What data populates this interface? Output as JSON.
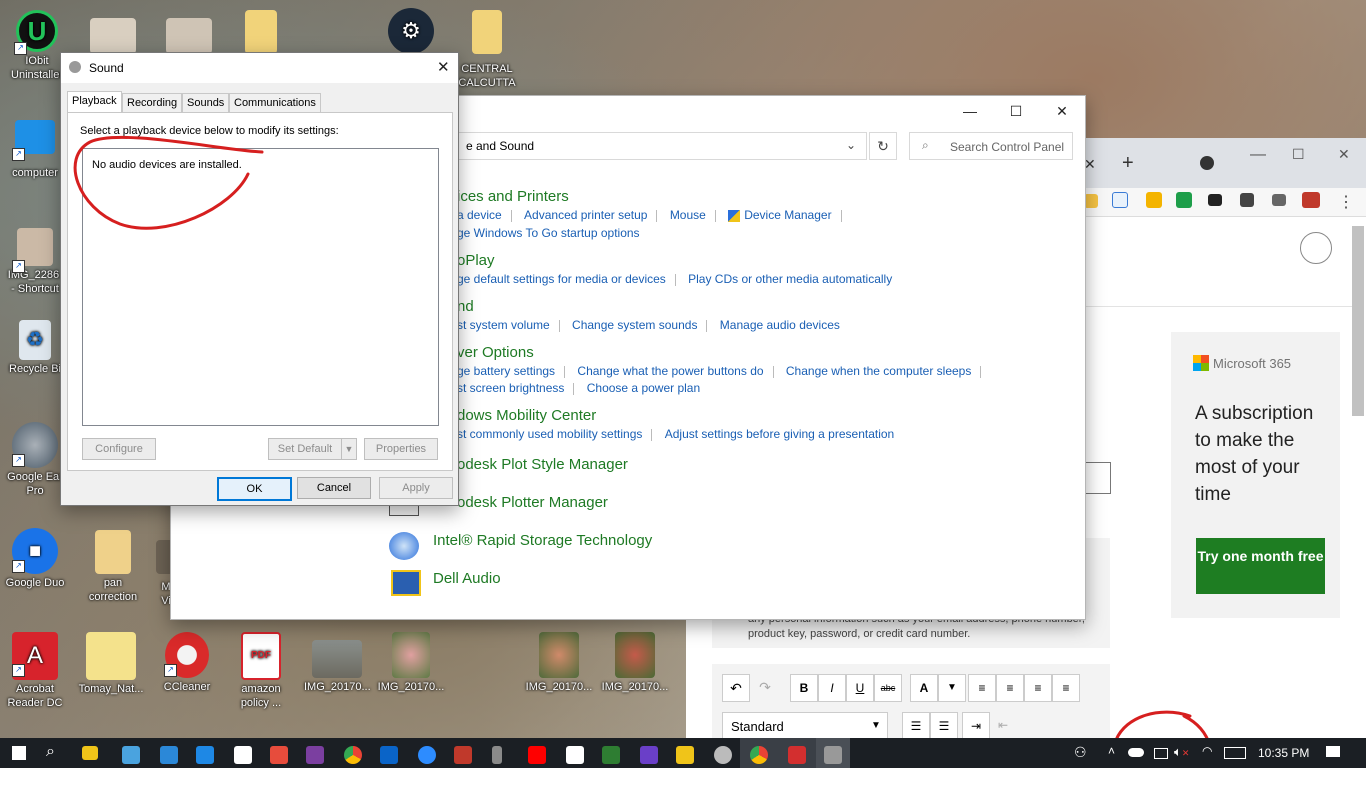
{
  "desktop": {
    "icons": [
      {
        "label": "IObit Uninstaller",
        "display": "IObit\nUninstaller"
      },
      {
        "label": "computer",
        "display": "computer"
      },
      {
        "label": "IMG_2286... - Shortcut",
        "display": "IMG_2286.\n- Shortcut"
      },
      {
        "label": "Recycle Bin",
        "display": "Recycle Bi"
      },
      {
        "label": "Google Earth Pro",
        "display": "Google Ear\nPro"
      },
      {
        "label": "Google Duo",
        "display": "Google Duo"
      },
      {
        "label": "Acrobat Reader DC",
        "display": "Acrobat\nReader DC"
      },
      {
        "label": "pan correction",
        "display": "pan\ncorrection"
      },
      {
        "label": "Tomay_Nat...",
        "display": "Tomay_Nat..."
      },
      {
        "label": "CCleaner",
        "display": "CCleaner"
      },
      {
        "label": "amazon policy ...",
        "display": "amazon\npolicy ..."
      },
      {
        "label": "IMG_20170...",
        "display": "IMG_20170..."
      },
      {
        "label": "IMG_20170...",
        "display": "IMG_20170..."
      },
      {
        "label": "IMG_20170...",
        "display": "IMG_20170..."
      },
      {
        "label": "IMG_20170...",
        "display": "IMG_20170..."
      },
      {
        "label": "CENTRAL CALCUTTA",
        "display": "CENTRAL\nCALCUTTA"
      },
      {
        "label": "M Vi",
        "display": "M\nVi"
      }
    ]
  },
  "sound_dialog": {
    "title": "Sound",
    "tabs": [
      "Playback",
      "Recording",
      "Sounds",
      "Communications"
    ],
    "instruction": "Select a playback device below to modify its settings:",
    "empty_message": "No audio devices are installed.",
    "buttons": {
      "configure": "Configure",
      "set_default": "Set Default",
      "properties": "Properties",
      "ok": "OK",
      "cancel": "Cancel",
      "apply": "Apply"
    }
  },
  "control_panel": {
    "address": "e and Sound",
    "search_placeholder": "Search Control Panel",
    "categories": [
      {
        "title": "ices and Printers",
        "links": [
          "a device",
          "Advanced printer setup",
          "Mouse",
          "Device Manager"
        ],
        "links2": [
          "ge Windows To Go startup options"
        ]
      },
      {
        "title": "oPlay",
        "links": [
          "ge default settings for media or devices",
          "Play CDs or other media automatically"
        ]
      },
      {
        "title": "nd",
        "links": [
          "st system volume",
          "Change system sounds",
          "Manage audio devices"
        ]
      },
      {
        "title": "ver Options",
        "links": [
          "ge battery settings",
          "Change what the power buttons do",
          "Change when the computer sleeps"
        ],
        "links2": [
          "st screen brightness",
          "Choose a power plan"
        ]
      },
      {
        "title": "dows Mobility Center",
        "links": [
          "st commonly used mobility settings",
          "Adjust settings before giving a presentation"
        ]
      },
      {
        "title": "odesk Plot Style Manager"
      },
      {
        "title": "odesk Plotter Manager"
      },
      {
        "title": "Intel® Rapid Storage Technology"
      },
      {
        "title": "Dell Audio"
      }
    ]
  },
  "browser": {
    "ad": {
      "brand": "Microsoft 365",
      "text": "A subscription to make the most of your time",
      "cta": "Try one month free"
    },
    "notice": "any personal information such as your email address, phone number, product key, password, or credit card number.",
    "editor": {
      "style_select": "Standard",
      "toolbar": [
        "undo",
        "redo",
        "bold",
        "italic",
        "underline",
        "strikethrough",
        "font-color",
        "align-left",
        "align-center",
        "align-right",
        "justify"
      ]
    }
  },
  "taskbar": {
    "time": "10:35 PM"
  },
  "colors": {
    "annotation": "#d61f1f",
    "cp_category": "#1e7a24",
    "cp_link": "#1a5fb4",
    "ms_green": "#1e7d22",
    "taskbar": "#1b1f24"
  }
}
